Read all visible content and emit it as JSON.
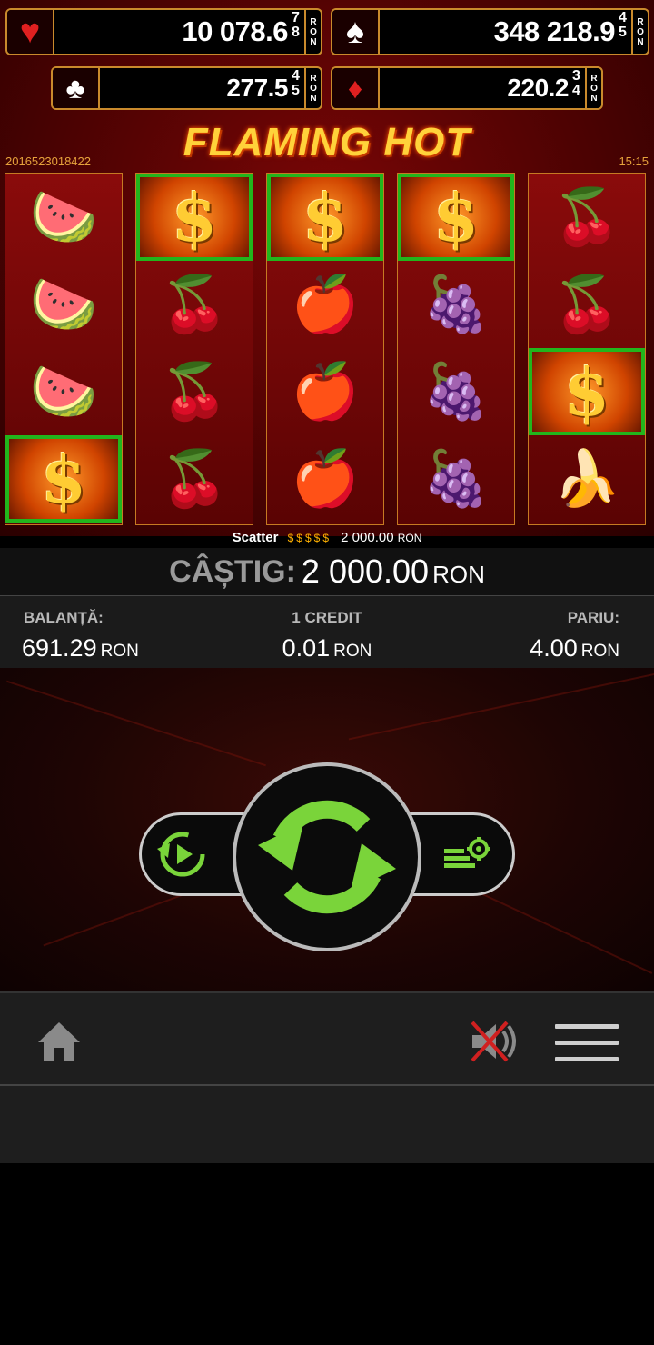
{
  "jackpots": [
    {
      "suit": "heart",
      "suit_icon": "♥",
      "suit_color": "#e02020",
      "value": "10 078.6",
      "digits": [
        "7",
        "8"
      ],
      "currency": "RON"
    },
    {
      "suit": "spade",
      "suit_icon": "♠",
      "suit_color": "#ffffff",
      "value": "348 218.9",
      "digits": [
        "4",
        "5"
      ],
      "currency": "RON"
    },
    {
      "suit": "club",
      "suit_icon": "♣",
      "suit_color": "#ffffff",
      "value": "277.5",
      "digits": [
        "4",
        "5"
      ],
      "currency": "RON"
    },
    {
      "suit": "diamond",
      "suit_icon": "♦",
      "suit_color": "#e02020",
      "value": "220.2",
      "digits": [
        "3",
        "4"
      ],
      "currency": "RON"
    }
  ],
  "title": "FLAMING HOT",
  "game_id": "2016523018422",
  "clock": "15:15",
  "reels": [
    [
      "watermelon",
      "watermelon",
      "watermelon",
      "dollar"
    ],
    [
      "dollar",
      "cherries",
      "cherries",
      "cherries"
    ],
    [
      "dollar",
      "apple",
      "apple",
      "apple"
    ],
    [
      "dollar",
      "grapes",
      "grapes",
      "grapes"
    ],
    [
      "cherries",
      "cherries",
      "dollar",
      "banana"
    ]
  ],
  "winning_cells": [
    [
      0,
      3
    ],
    [
      1,
      0
    ],
    [
      2,
      0
    ],
    [
      3,
      0
    ],
    [
      4,
      2
    ]
  ],
  "scatter": {
    "label": "Scatter",
    "amount": "2 000.00",
    "currency": "RON"
  },
  "win": {
    "label": "CÂȘTIG:",
    "amount": "2 000.00",
    "currency": "RON"
  },
  "stats": {
    "balance": {
      "label": "BALANȚĂ:",
      "value": "691.29",
      "currency": "RON"
    },
    "credit": {
      "label": "1 CREDIT",
      "value": "0.01",
      "currency": "RON"
    },
    "bet": {
      "label": "PARIU:",
      "value": "4.00",
      "currency": "RON"
    }
  },
  "colors": {
    "win_highlight": "#22b51c",
    "spin_arrows": "#7ad43a",
    "jackpot_border": "#c98a2c"
  }
}
